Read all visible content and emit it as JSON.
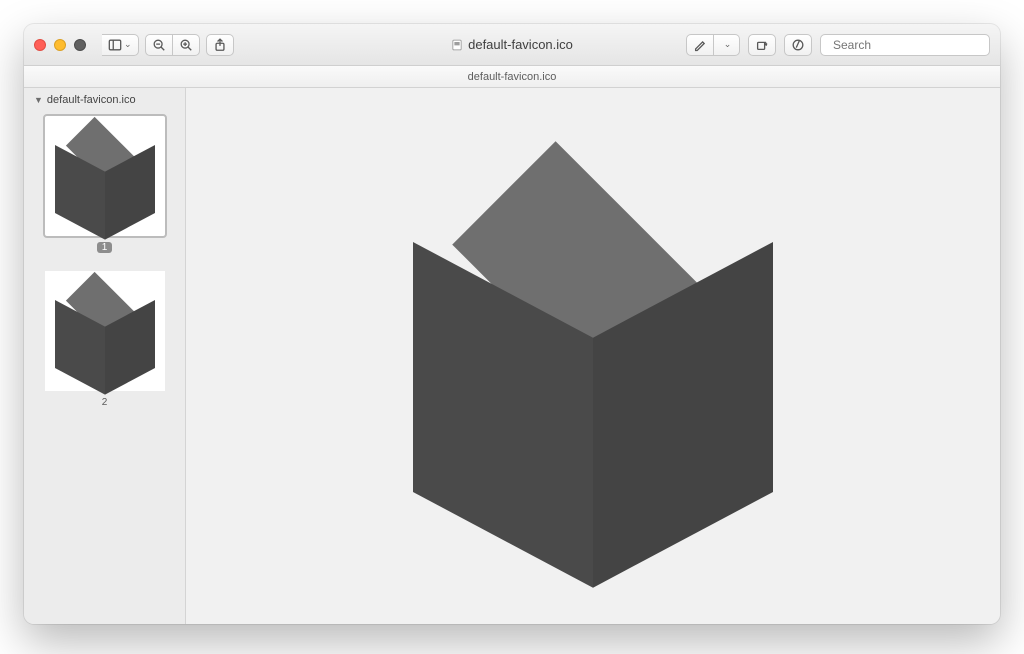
{
  "window_title": "default-favicon.ico",
  "document_name": "default-favicon.ico",
  "search_placeholder": "Search",
  "sidebar": {
    "file_label": "default-favicon.ico",
    "thumbs": [
      {
        "label": "1",
        "selected": true
      },
      {
        "label": "2",
        "selected": false
      }
    ]
  }
}
